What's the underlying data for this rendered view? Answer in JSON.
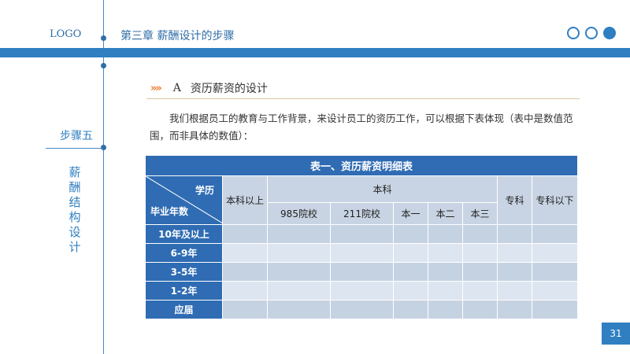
{
  "header": {
    "logo": "LOGO",
    "chapter": "第三章  薪酬设计的步骤"
  },
  "section": {
    "chevrons": "»»",
    "letter": "A",
    "title": "资历薪资的设计"
  },
  "intro": "我们根据员工的教育与工作背景，来设计员工的资历工作，可以根据下表体现（表中是数值范围，而非具体的数值）：",
  "sidebar": {
    "step": "步骤五",
    "vertical_title": "薪酬结构设计"
  },
  "table": {
    "caption": "表一、资历薪资明细表",
    "corner_top": "学历",
    "corner_bottom": "毕业年数",
    "above_bachelor": "本科以上",
    "bachelor": "本科",
    "bachelor_sub": [
      "985院校",
      "211院校",
      "本一",
      "本二",
      "本三"
    ],
    "junior_college": "专科",
    "below_junior": "专科以下",
    "rows": [
      "10年及以上",
      "6-9年",
      "3-5年",
      "1-2年",
      "应届"
    ]
  },
  "page_number": "31",
  "colors": {
    "accent": "#2f7fc1",
    "table_header": "#2f6cb3",
    "chevron": "#ed7d31"
  }
}
